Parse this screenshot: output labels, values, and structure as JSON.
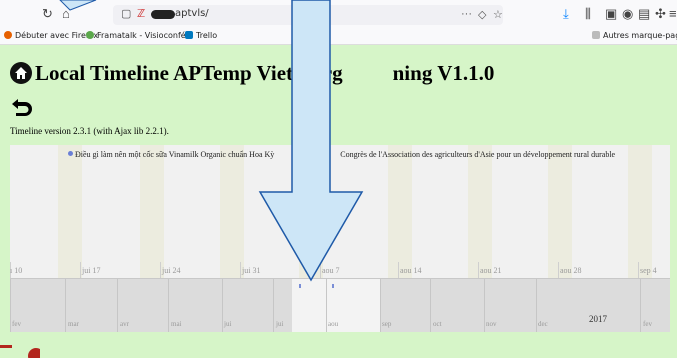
{
  "browser": {
    "url_text": "aptvls/",
    "right_icons": [
      "...",
      "pocket-icon",
      "star-icon"
    ],
    "bookmarks": [
      {
        "label": "Débuter avec Firefox",
        "color": "#e66000"
      },
      {
        "label": "Framatalk - Visioconfé...",
        "color": "#5ca84c"
      },
      {
        "label": "Trello",
        "color": "#0079bf"
      }
    ],
    "other_bookmarks": "Autres marque-pages"
  },
  "page": {
    "title_part1": "Local Timeline APTemp Viet Larg",
    "title_part2": "ning V1.1.0",
    "version_text": "Timeline version 2.3.1 (with Ajax lib 2.2.1)."
  },
  "timeline": {
    "event_text": "Điều gì làm nên một cốc sữa Vinamilk Organic chuẩn Hoa Kỳ",
    "event_text_2": "Congrès de l'Association des agriculteurs d'Asie pour un développement rural durable",
    "day_labels": [
      "ı 10",
      "jui 17",
      "jui 24",
      "jui 31",
      "aou 7",
      "aou 14",
      "aou 21",
      "aou 28",
      "sep 4"
    ],
    "month_labels": [
      "fev",
      "mar",
      "avr",
      "mai",
      "jui",
      "jui",
      "aou",
      "sep",
      "oct",
      "nov",
      "dec",
      "fev"
    ],
    "year_label": "2017"
  },
  "colors": {
    "page_bg": "#d6f5c8",
    "arrow_fill": "#cde6f7",
    "arrow_stroke": "#1f5aa8"
  }
}
